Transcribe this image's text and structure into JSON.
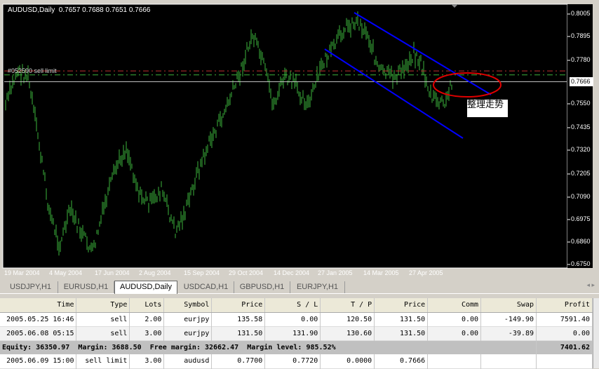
{
  "chart": {
    "title": "AUDUSD,Daily",
    "ohlc": "0.7657 0.7688 0.7651 0.7666",
    "order_label": "#052590 sell limit",
    "annotation": "整理走势",
    "current_price": "0.7666",
    "price_labels": [
      "0.8005",
      "0.7895",
      "0.7780",
      "0.7550",
      "0.7435",
      "0.7320",
      "0.7205",
      "0.7090",
      "0.6975",
      "0.6860",
      "0.6750"
    ],
    "date_labels": [
      "19 Mar 2004",
      "4 May 2004",
      "17 Jun 2004",
      "2 Aug 2004",
      "15 Sep 2004",
      "29 Oct 2004",
      "14 Dec 2004",
      "27 Jan 2005",
      "14 Mar 2005",
      "27 Apr 2005"
    ],
    "sell_limit_price": 0.77,
    "stop_loss_price": 0.772,
    "colors": {
      "bars": "#3cb43c",
      "channel": "#0000ff",
      "ellipse": "#e00000"
    }
  },
  "tabs": [
    "USDJPY,H1",
    "EURUSD,H1",
    "AUDUSD,Daily",
    "USDCAD,H1",
    "GBPUSD,H1",
    "EURJPY,H1"
  ],
  "terminal": {
    "columns": [
      "Time",
      "Type",
      "Lots",
      "Symbol",
      "Price",
      "S / L",
      "T / P",
      "Price",
      "Comm",
      "Swap",
      "Profit"
    ],
    "rows": [
      [
        "2005.05.25 16:46",
        "sell",
        "2.00",
        "eurjpy",
        "135.58",
        "0.00",
        "120.50",
        "131.50",
        "0.00",
        "-149.90",
        "7591.40"
      ],
      [
        "2005.06.08 05:15",
        "sell",
        "3.00",
        "eurjpy",
        "131.50",
        "131.90",
        "130.60",
        "131.50",
        "0.00",
        "-39.89",
        "0.00"
      ]
    ],
    "equity": "Equity: 36350.97  Margin: 3688.50  Free margin: 32662.47  Margin level: 985.52%",
    "total_profit": "7401.62",
    "pending": [
      "2005.06.09 15:00",
      "sell limit",
      "3.00",
      "audusd",
      "0.7700",
      "0.7720",
      "0.0000",
      "0.7666",
      "",
      "",
      ""
    ]
  }
}
